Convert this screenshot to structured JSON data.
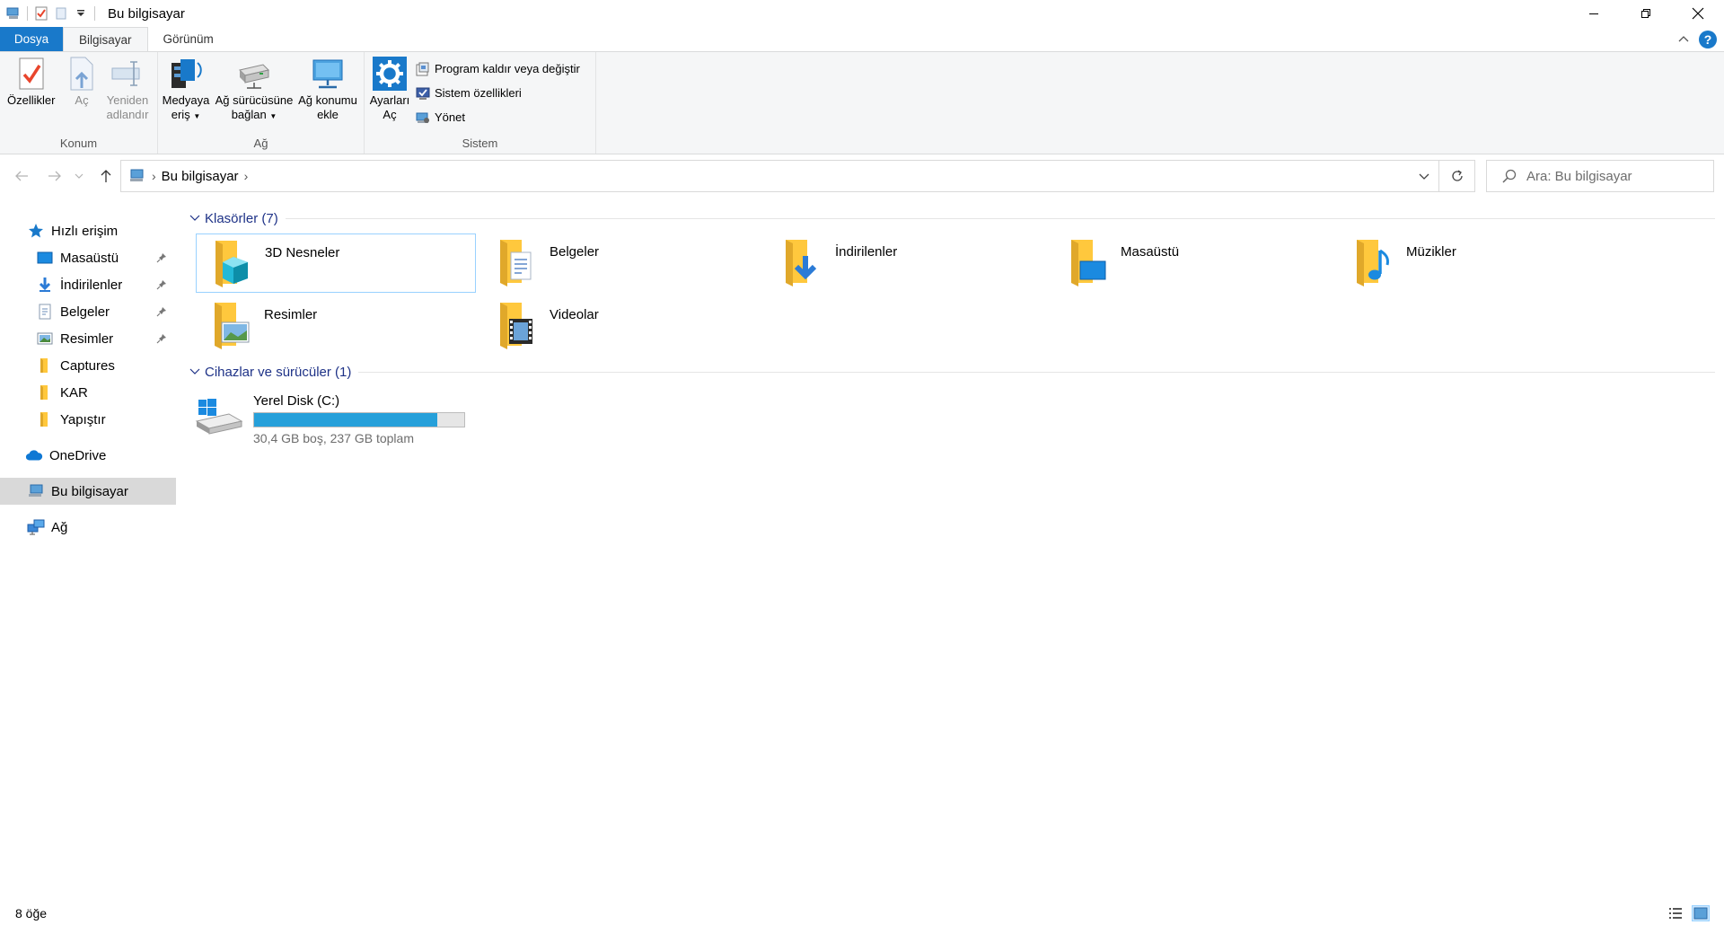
{
  "window": {
    "title": "Bu bilgisayar",
    "controls": [
      "minimize",
      "maximize",
      "close"
    ]
  },
  "tabs": [
    {
      "label": "Dosya",
      "kind": "file"
    },
    {
      "label": "Bilgisayar",
      "kind": "active"
    },
    {
      "label": "Görünüm",
      "kind": "normal"
    }
  ],
  "ribbon": {
    "groups": {
      "konum": {
        "label": "Konum",
        "buttons": [
          {
            "label": "Özellikler",
            "icon": "properties-icon"
          },
          {
            "label": "Aç",
            "icon": "open-icon"
          },
          {
            "label": "Yeniden adlandır",
            "icon": "rename-icon"
          }
        ]
      },
      "ag": {
        "label": "Ağ",
        "buttons": [
          {
            "label": "Medyaya eriş",
            "icon": "media-access-icon"
          },
          {
            "label": "Ağ sürücüsüne bağlan",
            "icon": "network-drive-icon"
          },
          {
            "label": "Ağ konumu ekle",
            "icon": "network-location-icon"
          }
        ]
      },
      "sistem": {
        "label": "Sistem",
        "open_settings": "Ayarları Aç",
        "small": [
          {
            "label": "Program kaldır veya değiştir",
            "icon": "uninstall-icon"
          },
          {
            "label": "Sistem özellikleri",
            "icon": "system-properties-icon"
          },
          {
            "label": "Yönet",
            "icon": "manage-icon"
          }
        ]
      }
    }
  },
  "address": {
    "crumb": "Bu bilgisayar",
    "search_placeholder": "Ara: Bu bilgisayar"
  },
  "nav": {
    "items": [
      {
        "label": "Hızlı erişim",
        "icon": "star-icon",
        "pinned": false
      },
      {
        "label": "Masaüstü",
        "icon": "desktop-icon",
        "pinned": true
      },
      {
        "label": "İndirilenler",
        "icon": "download-icon",
        "pinned": true
      },
      {
        "label": "Belgeler",
        "icon": "documents-icon",
        "pinned": true
      },
      {
        "label": "Resimler",
        "icon": "pictures-icon",
        "pinned": true
      },
      {
        "label": "Captures",
        "icon": "folder-icon",
        "pinned": false
      },
      {
        "label": "KAR",
        "icon": "folder-icon",
        "pinned": false
      },
      {
        "label": "Yapıştır",
        "icon": "folder-icon",
        "pinned": false
      },
      {
        "label": "OneDrive",
        "icon": "onedrive-icon",
        "pinned": false
      },
      {
        "label": "Bu bilgisayar",
        "icon": "this-pc-icon",
        "pinned": false,
        "selected": true
      },
      {
        "label": "Ağ",
        "icon": "network-icon",
        "pinned": false
      }
    ]
  },
  "folders_section": {
    "title": "Klasörler (7)",
    "items": [
      {
        "name": "3D Nesneler",
        "icon": "3d-objects-folder-icon"
      },
      {
        "name": "Belgeler",
        "icon": "documents-folder-icon"
      },
      {
        "name": "İndirilenler",
        "icon": "downloads-folder-icon"
      },
      {
        "name": "Masaüstü",
        "icon": "desktop-folder-icon"
      },
      {
        "name": "Müzikler",
        "icon": "music-folder-icon"
      },
      {
        "name": "Resimler",
        "icon": "pictures-folder-icon"
      },
      {
        "name": "Videolar",
        "icon": "videos-folder-icon"
      }
    ]
  },
  "devices_section": {
    "title": "Cihazlar ve sürücüler (1)",
    "drive": {
      "name": "Yerel Disk (C:)",
      "size_text": "30,4 GB boş, 237 GB toplam",
      "used_fraction": 0.872
    }
  },
  "status": {
    "count": "8 öğe"
  },
  "colors": {
    "accent": "#1979ca",
    "section_text": "#1e3287",
    "drive_bar": "#26a0da",
    "folder": "#ffc83d"
  }
}
